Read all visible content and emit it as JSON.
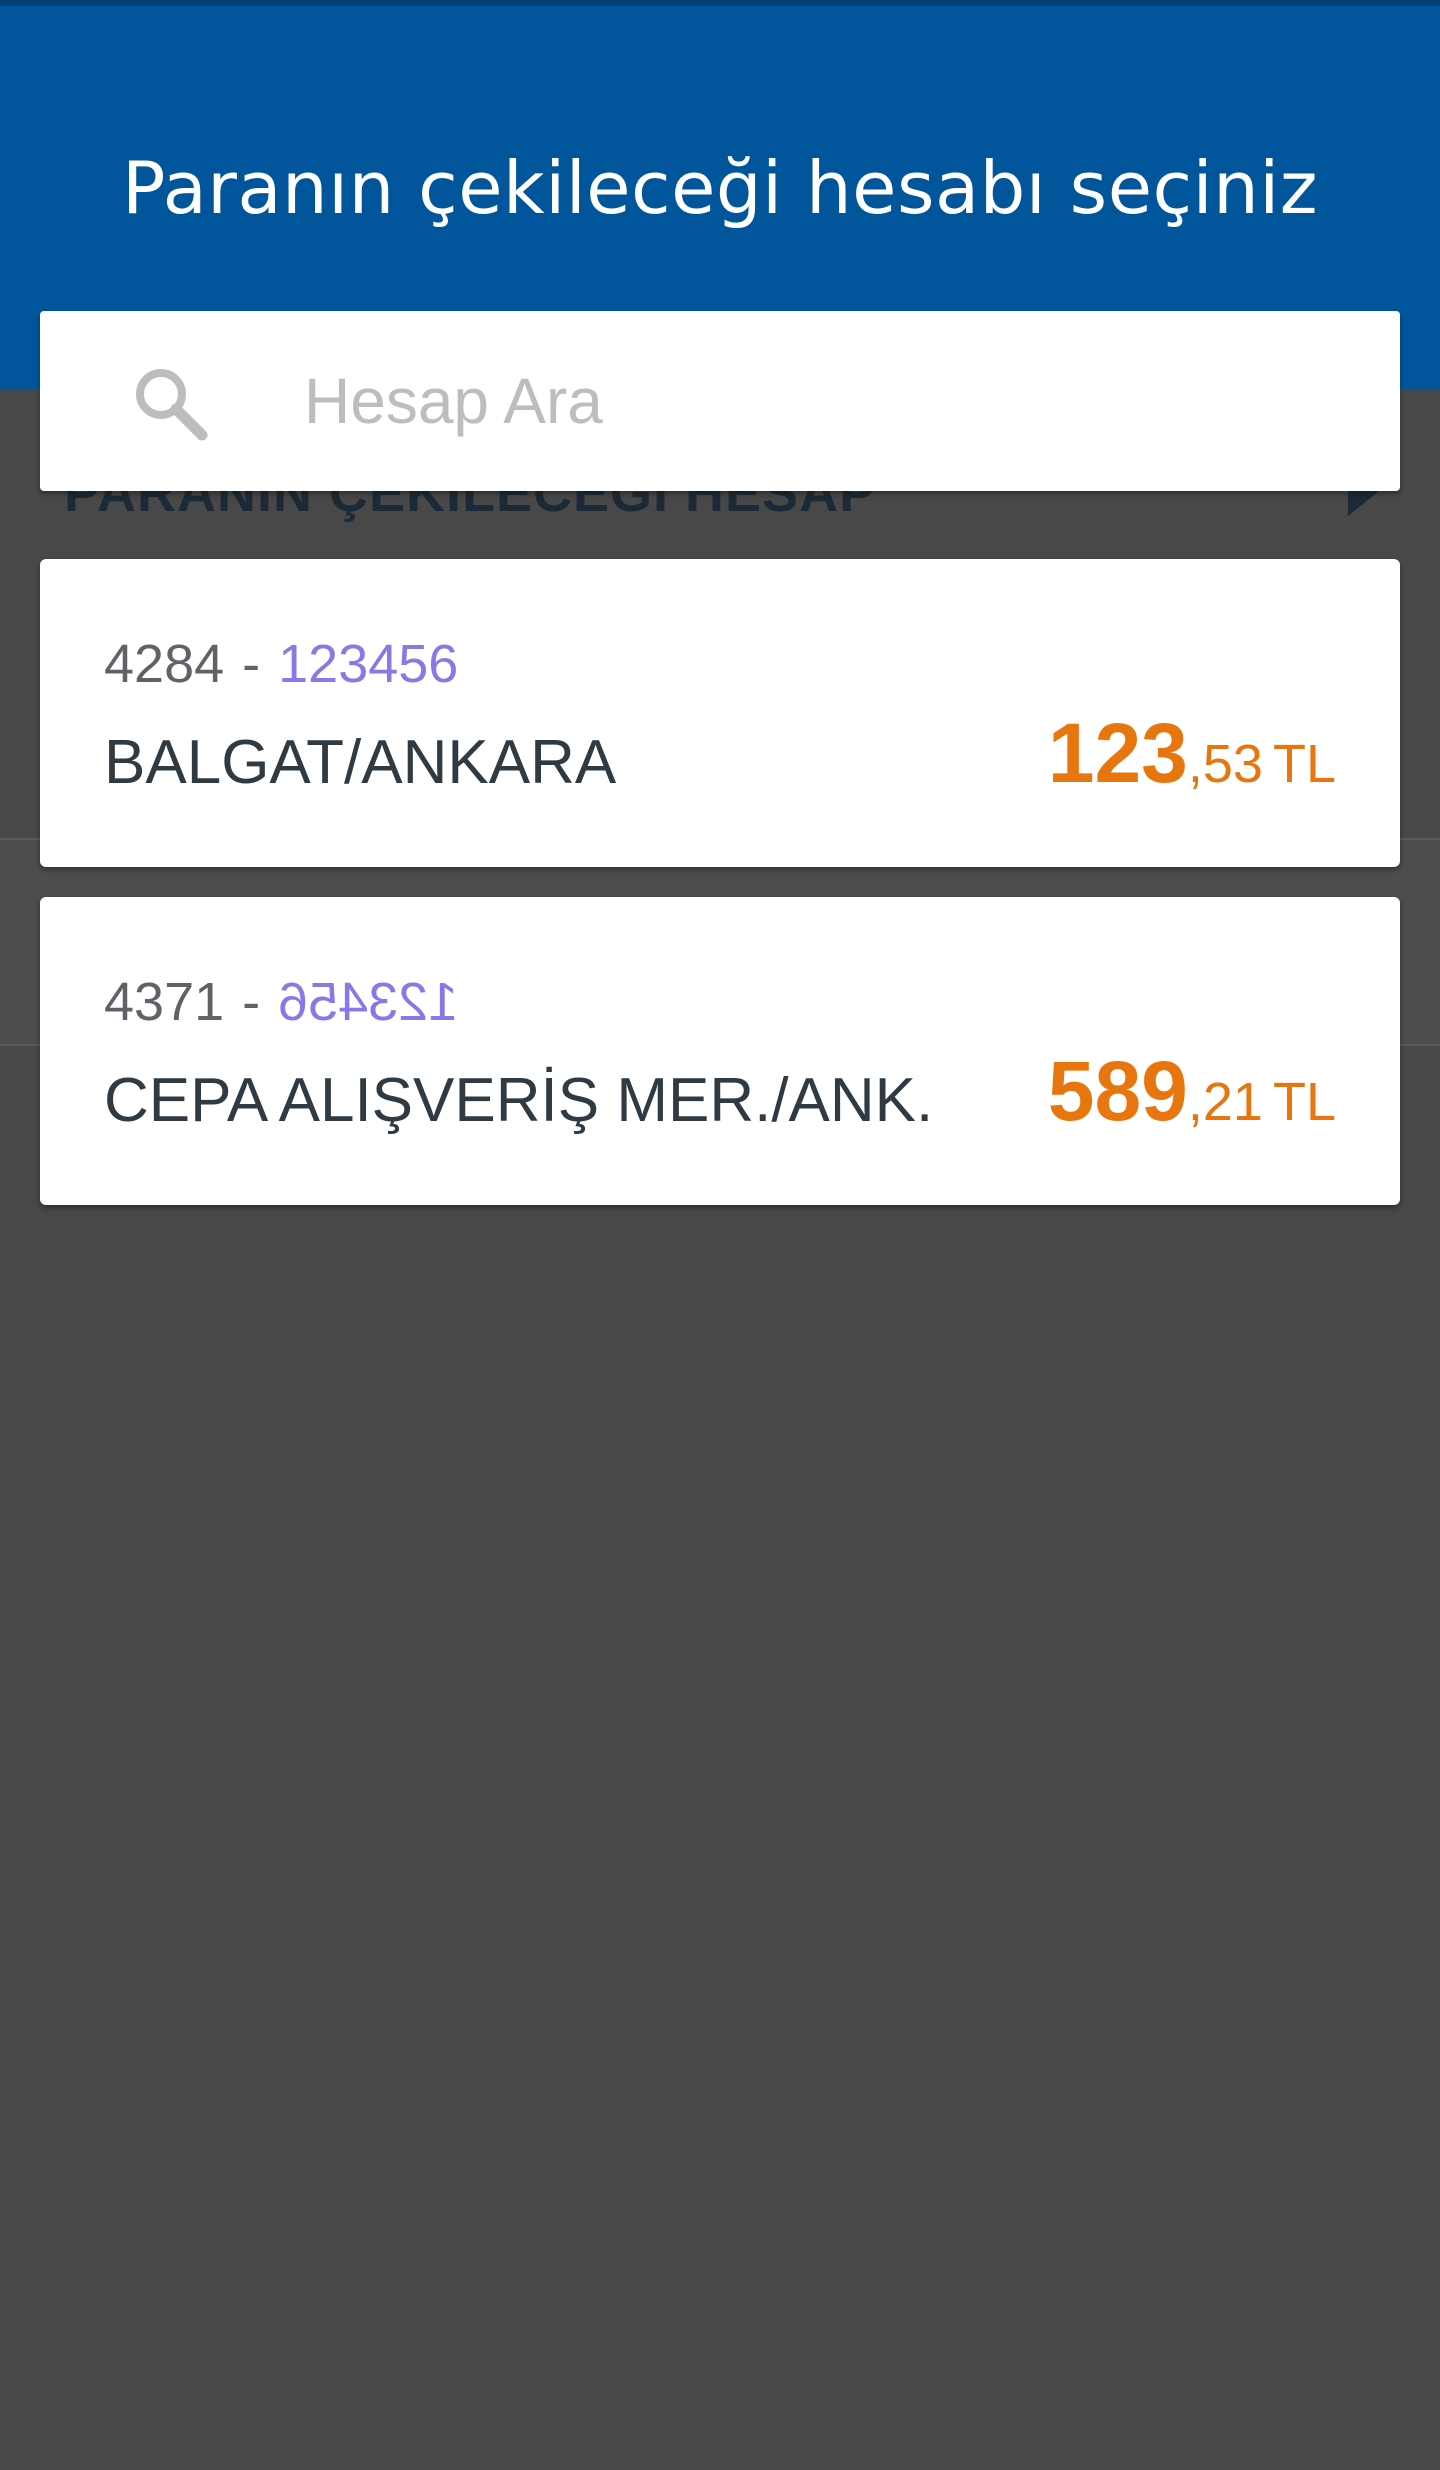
{
  "header": {
    "title": "Paranın çekileceği hesabı seçiniz"
  },
  "search": {
    "placeholder": "Hesap Ara",
    "value": ""
  },
  "background": {
    "section_label": "PARANIN ÇEKİLECEĞİ HESAP"
  },
  "accounts": [
    {
      "branch": "4284",
      "separator": "-",
      "number": "123456",
      "name": "BALGAT/ANKARA",
      "balance_int": "123",
      "balance_dec": ",53",
      "currency": "TL"
    },
    {
      "branch": "4371",
      "separator": "-",
      "number": "123456",
      "name": "CEPA ALIŞVERİŞ MER./ANK.",
      "balance_int": "589",
      "balance_dec": ",21",
      "currency": "TL"
    }
  ],
  "colors": {
    "header_blue": "#01569b",
    "balance_orange": "#e8760f",
    "account_number_purple": "#8a78e6",
    "overlay_dark": "#484848"
  },
  "icons": {
    "search": "search-icon",
    "arrow": "chevron-right-icon"
  }
}
